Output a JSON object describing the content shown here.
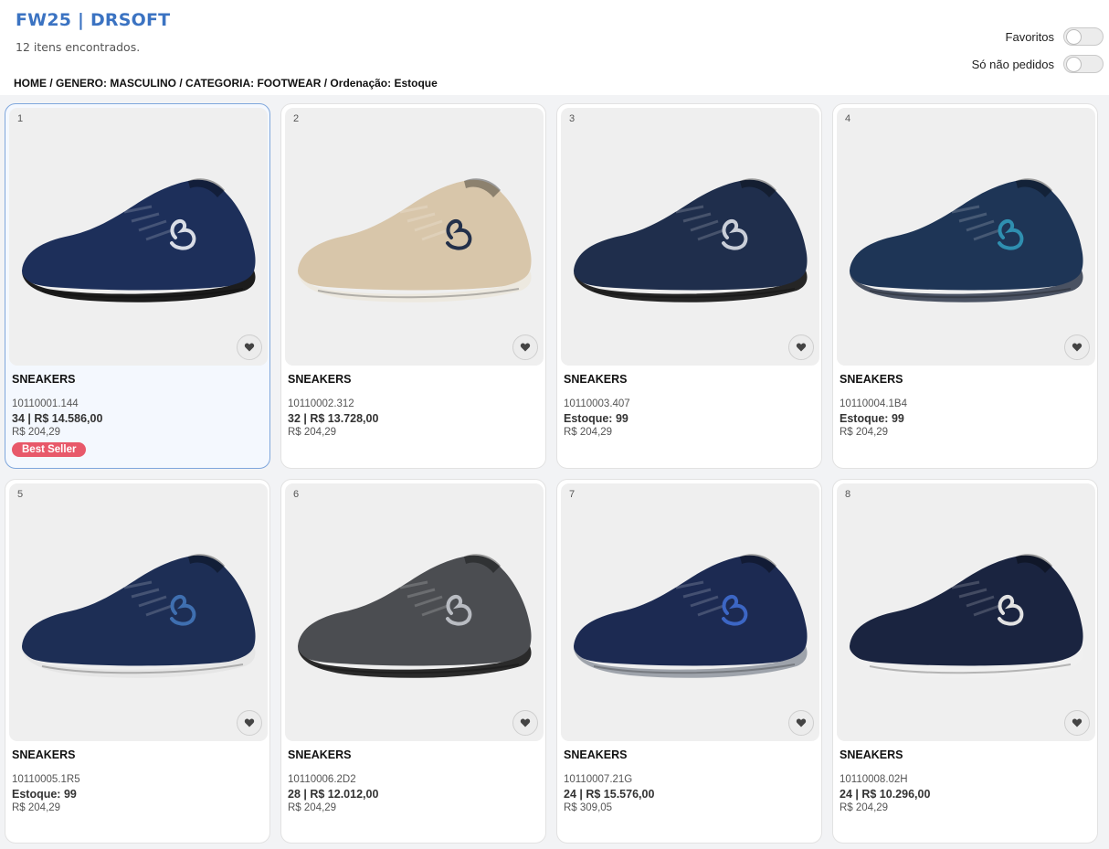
{
  "header": {
    "title": "FW25 | DRSOFT",
    "count": "12 itens encontrados.",
    "breadcrumb": "HOME / GENERO: MASCULINO / CATEGORIA: FOOTWEAR / Ordenação: Estoque",
    "toggles": [
      {
        "label": "Favoritos",
        "on": false
      },
      {
        "label": "Só não pedidos",
        "on": false
      }
    ]
  },
  "products": [
    {
      "index": "1",
      "name": "SNEAKERS",
      "sku": "10110001.144",
      "line": "34 | R$ 14.586,00",
      "price": "R$ 204,29",
      "badge": "Best Seller",
      "selected": true,
      "colors": {
        "upper": "#1d2f5a",
        "sole": "#1c1c1c",
        "logo": "#d9dde6"
      }
    },
    {
      "index": "2",
      "name": "SNEAKERS",
      "sku": "10110002.312",
      "line": "32 | R$ 13.728,00",
      "price": "R$ 204,29",
      "badge": "",
      "colors": {
        "upper": "#d8c6aa",
        "sole": "#ede9e0",
        "logo": "#23304a"
      }
    },
    {
      "index": "3",
      "name": "SNEAKERS",
      "sku": "10110003.407",
      "line": "Estoque: 99",
      "price": "R$ 204,29",
      "badge": "",
      "colors": {
        "upper": "#1f2e4c",
        "sole": "#252525",
        "logo": "#c9ced8"
      }
    },
    {
      "index": "4",
      "name": "SNEAKERS",
      "sku": "10110004.1B4",
      "line": "Estoque: 99",
      "price": "R$ 204,29",
      "badge": "",
      "colors": {
        "upper": "#1e3556",
        "sole": "#4a5262",
        "logo": "#2f8fb0"
      }
    },
    {
      "index": "5",
      "name": "SNEAKERS",
      "sku": "10110005.1R5",
      "line": "Estoque: 99",
      "price": "R$ 204,29",
      "badge": "",
      "colors": {
        "upper": "#1d2e55",
        "sole": "#e6e6e6",
        "logo": "#3f6fb0"
      }
    },
    {
      "index": "6",
      "name": "SNEAKERS",
      "sku": "10110006.2D2",
      "line": "28 | R$ 12.012,00",
      "price": "R$ 204,29",
      "badge": "",
      "colors": {
        "upper": "#4b4d51",
        "sole": "#2a2a2a",
        "logo": "#b9bcc2"
      }
    },
    {
      "index": "7",
      "name": "SNEAKERS",
      "sku": "10110007.21G",
      "line": "24 | R$ 15.576,00",
      "price": "R$ 309,05",
      "badge": "",
      "colors": {
        "upper": "#1c2a52",
        "sole": "#9ea3ab",
        "logo": "#3c66c4"
      }
    },
    {
      "index": "8",
      "name": "SNEAKERS",
      "sku": "10110008.02H",
      "line": "24 | R$ 10.296,00",
      "price": "R$ 204,29",
      "badge": "",
      "colors": {
        "upper": "#1a2440",
        "sole": "#f0f0f0",
        "logo": "#e2e2e2"
      }
    }
  ]
}
